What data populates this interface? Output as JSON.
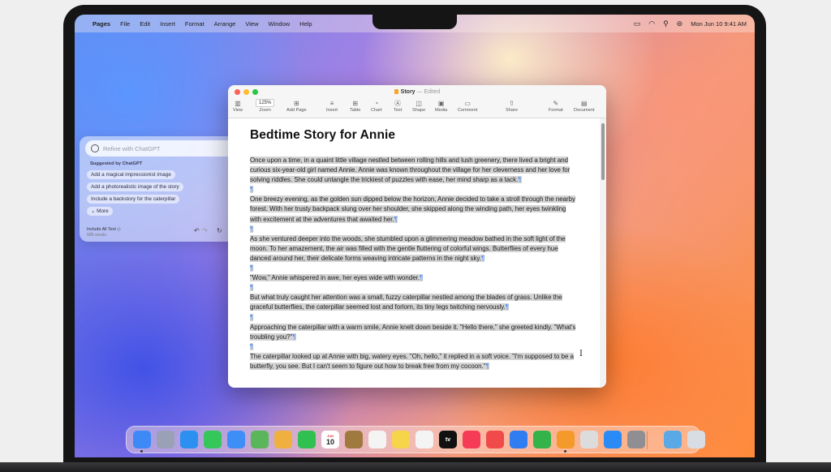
{
  "menubar": {
    "app_name": "Pages",
    "items": [
      "File",
      "Edit",
      "Insert",
      "Format",
      "Arrange",
      "View",
      "Window",
      "Help"
    ],
    "datetime": "Mon Jun 10 9:41 AM"
  },
  "window": {
    "title": "Story",
    "status": "— Edited",
    "zoom": "125%",
    "toolbar": {
      "view": "View",
      "zoom": "Zoom",
      "add_page": "Add Page",
      "insert": "Insert",
      "table": "Table",
      "chart": "Chart",
      "text": "Text",
      "shape": "Shape",
      "media": "Media",
      "comment": "Comment",
      "share": "Share",
      "format": "Format",
      "document": "Document"
    }
  },
  "document": {
    "heading": "Bedtime Story for Annie",
    "paragraphs": [
      "Once upon a time, in a quaint little village nestled between rolling hills and lush greenery, there lived a bright and curious six-year-old girl named Annie. Annie was known throughout the village for her cleverness and her love for solving riddles. She could untangle the trickiest of puzzles with ease, her mind sharp as a tack.",
      "One breezy evening, as the golden sun dipped below the horizon, Annie decided to take a stroll through the nearby forest. With her trusty backpack slung over her shoulder, she skipped along the winding path, her eyes twinkling with excitement at the adventures that awaited her.",
      "As she ventured deeper into the woods, she stumbled upon a glimmering meadow bathed in the soft light of the moon. To her amazement, the air was filled with the gentle fluttering of colorful wings. Butterflies of every hue danced around her, their delicate forms weaving intricate patterns in the night sky.",
      "\"Wow,\" Annie whispered in awe, her eyes wide with wonder.",
      "But what truly caught her attention was a small, fuzzy caterpillar nestled among the blades of grass. Unlike the graceful butterflies, the caterpillar seemed lost and forlorn, its tiny legs twitching nervously.",
      "Approaching the caterpillar with a warm smile, Annie knelt down beside it. \"Hello there,\" she greeted kindly. \"What's troubling you?\"",
      "The caterpillar looked up at Annie with big, watery eyes. \"Oh, hello,\" it replied in a soft voice. \"I'm supposed to be a butterfly, you see. But I can't seem to figure out how to break free from my cocoon.\""
    ],
    "pilcrow": "¶"
  },
  "chatgpt_panel": {
    "placeholder": "Refine with ChatGPT",
    "suggested_heading": "Suggested by ChatGPT",
    "suggestions": [
      "Add a magical impressionist image",
      "Add a photorealistic image of the story",
      "Include a backstory for the caterpillar"
    ],
    "more": "More",
    "include_label": "Include All Text",
    "word_count": "585 words"
  },
  "dock": {
    "apps": [
      {
        "name": "finder",
        "color": "#3d8af7"
      },
      {
        "name": "launchpad",
        "color": "#9aa0b5"
      },
      {
        "name": "safari",
        "color": "#2b90f0"
      },
      {
        "name": "messages",
        "color": "#35c759"
      },
      {
        "name": "mail",
        "color": "#3d8ef7"
      },
      {
        "name": "maps",
        "color": "#5ab65a"
      },
      {
        "name": "photos",
        "color": "#f0b040"
      },
      {
        "name": "facetime",
        "color": "#30c050"
      },
      {
        "name": "calendar",
        "color": "#ffffff"
      },
      {
        "name": "notes",
        "color": "#a0793f"
      },
      {
        "name": "reminders",
        "color": "#f4f4f4"
      },
      {
        "name": "notes-yellow",
        "color": "#f6d54a"
      },
      {
        "name": "freeform",
        "color": "#f4f4f4"
      },
      {
        "name": "apple-tv",
        "color": "#111111"
      },
      {
        "name": "music",
        "color": "#f53b55"
      },
      {
        "name": "news",
        "color": "#f04a4a"
      },
      {
        "name": "keynote",
        "color": "#2f7df0"
      },
      {
        "name": "numbers",
        "color": "#34b34a"
      },
      {
        "name": "pages",
        "color": "#f39a2a"
      },
      {
        "name": "iphone-mirroring",
        "color": "#dcdcdc"
      },
      {
        "name": "app-store",
        "color": "#2a8af6"
      },
      {
        "name": "system-settings",
        "color": "#8e8e93"
      },
      {
        "name": "downloads-folder",
        "color": "#5aa9e6"
      },
      {
        "name": "trash",
        "color": "#d8dde3"
      }
    ],
    "calendar_day": "10",
    "calendar_month": "JUN",
    "tv_label": "tv"
  }
}
